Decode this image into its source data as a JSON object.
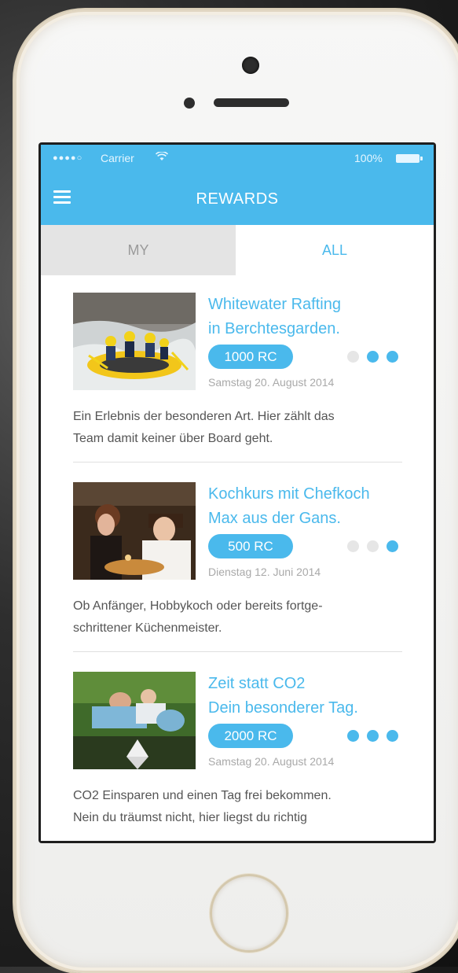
{
  "status_bar": {
    "signal": "●●●●○",
    "carrier": "Carrier",
    "wifi_icon": "wifi-icon",
    "battery": "100%"
  },
  "nav": {
    "title": "REWARDS",
    "menu_icon": "hamburger-menu-icon"
  },
  "tabs": [
    {
      "label": "MY",
      "active": false
    },
    {
      "label": "ALL",
      "active": true
    }
  ],
  "colors": {
    "accent": "#4ab9ec",
    "inactive_tab_bg": "#e4e4e4",
    "dot_off": "#e6e6e6"
  },
  "rewards": [
    {
      "title_line1": "Whitewater Rafting",
      "title_line2": "in Berchtesgarden.",
      "points": "1000 RC",
      "dots_filled": 2,
      "date": "Samstag 20. August 2014",
      "desc_line1": "Ein Erlebnis der besonderen Art. Hier zählt das",
      "desc_line2": "Team damit keiner über Board geht."
    },
    {
      "title_line1": "Kochkurs mit Chefkoch",
      "title_line2": "Max aus der Gans.",
      "points": "500 RC",
      "dots_filled": 1,
      "date": "Dienstag 12. Juni 2014",
      "desc_line1": "Ob Anfänger, Hobbykoch oder bereits fortge-",
      "desc_line2": "schrittener Küchenmeister."
    },
    {
      "title_line1": "Zeit statt CO2",
      "title_line2": "Dein besonderer Tag.",
      "points": "2000 RC",
      "dots_filled": 3,
      "date": "Samstag 20. August 2014",
      "desc_line1": "CO2 Einsparen und einen Tag frei bekommen.",
      "desc_line2": "Nein du träumst nicht, hier liegst du richtig"
    }
  ]
}
